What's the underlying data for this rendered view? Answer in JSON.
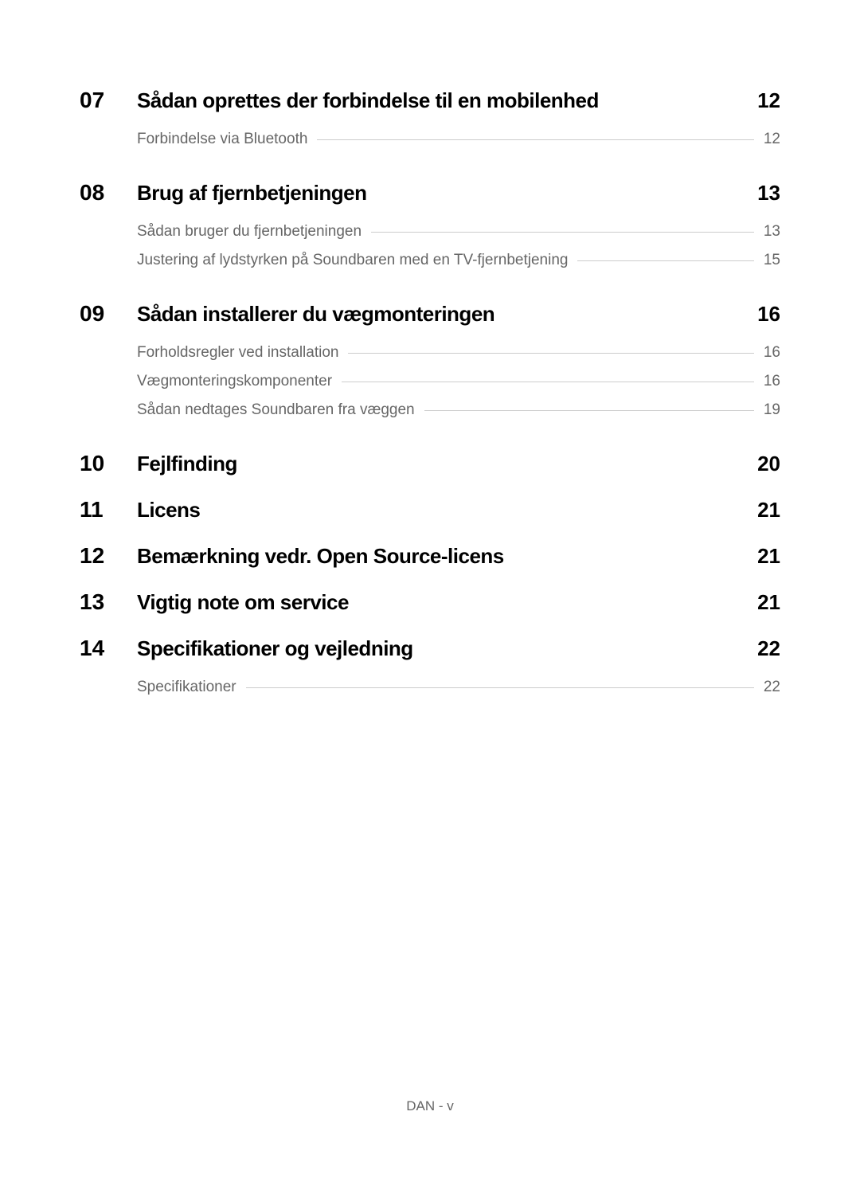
{
  "sections": [
    {
      "number": "07",
      "title": "Sådan oprettes der forbindelse til en mobilenhed",
      "page": "12",
      "subs": [
        {
          "title": "Forbindelse via Bluetooth",
          "page": "12"
        }
      ]
    },
    {
      "number": "08",
      "title": "Brug af fjernbetjeningen",
      "page": "13",
      "subs": [
        {
          "title": "Sådan bruger du fjernbetjeningen",
          "page": "13"
        },
        {
          "title": "Justering af lydstyrken på Soundbaren med en TV-fjernbetjening",
          "page": "15"
        }
      ]
    },
    {
      "number": "09",
      "title": "Sådan installerer du vægmonteringen",
      "page": "16",
      "subs": [
        {
          "title": "Forholdsregler ved installation",
          "page": "16"
        },
        {
          "title": "Vægmonteringskomponenter",
          "page": "16"
        },
        {
          "title": "Sådan nedtages Soundbaren fra væggen",
          "page": "19"
        }
      ]
    },
    {
      "number": "10",
      "title": "Fejlfinding",
      "page": "20",
      "subs": []
    },
    {
      "number": "11",
      "title": "Licens",
      "page": "21",
      "subs": []
    },
    {
      "number": "12",
      "title": "Bemærkning vedr. Open Source-licens",
      "page": "21",
      "subs": []
    },
    {
      "number": "13",
      "title": "Vigtig note om service",
      "page": "21",
      "subs": []
    },
    {
      "number": "14",
      "title": "Specifikationer og vejledning",
      "page": "22",
      "subs": [
        {
          "title": "Specifikationer",
          "page": "22"
        }
      ]
    }
  ],
  "footer": "DAN - v"
}
